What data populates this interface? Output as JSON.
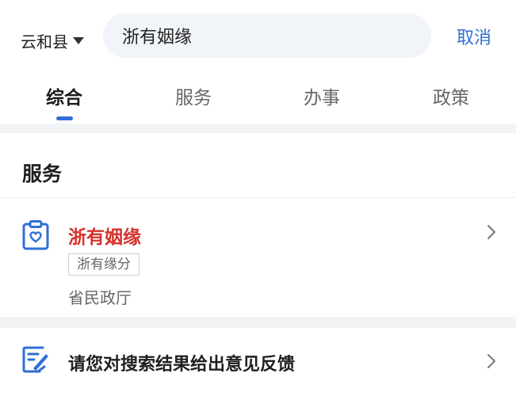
{
  "search": {
    "region": "云和县",
    "query": "浙有姻缘",
    "cancel_label": "取消"
  },
  "tabs": [
    {
      "label": "综合",
      "active": true
    },
    {
      "label": "服务",
      "active": false
    },
    {
      "label": "办事",
      "active": false
    },
    {
      "label": "政策",
      "active": false
    }
  ],
  "service_section": {
    "title": "服务",
    "item": {
      "name": "浙有姻缘",
      "tag": "浙有缘分",
      "department": "省民政厅",
      "icon": "clipboard-heart-icon"
    }
  },
  "feedback": {
    "text": "请您对搜索结果给出意见反馈",
    "icon": "edit-document-icon"
  },
  "colors": {
    "accent": "#2f6fd6",
    "highlight_red": "#d6312c",
    "band_gray": "#f2f3f5"
  }
}
